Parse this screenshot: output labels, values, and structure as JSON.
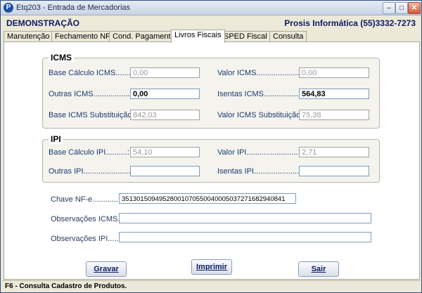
{
  "window": {
    "title": "Etq203 - Entrada de Mercadorias",
    "icon_letter": "P"
  },
  "header": {
    "demo": "DEMONSTRAÇÃO",
    "company": "Prosis Informática (55)3332-7273"
  },
  "tabs": [
    {
      "label": "Manutenção"
    },
    {
      "label": "Fechamento NF"
    },
    {
      "label": "Cond. Pagamento"
    },
    {
      "label": "Livros Fiscais",
      "active": true
    },
    {
      "label": "SPED Fiscal"
    },
    {
      "label": "Consulta"
    }
  ],
  "icms": {
    "title": "ICMS",
    "base_calculo": {
      "label": "Base Cálculo ICMS........:",
      "value": "0,00"
    },
    "valor": {
      "label": "Valor  ICMS.........................:",
      "value": "0,00"
    },
    "outras": {
      "label": "Outras  ICMS......................:",
      "value": "0,00"
    },
    "isentas": {
      "label": "Isentas  ICMS......................:",
      "value": "564,83"
    },
    "base_subst": {
      "label": "Base ICMS Substituição:",
      "value": "842,03"
    },
    "valor_subst": {
      "label": "Valor  ICMS Substituição:",
      "value": "75,38"
    }
  },
  "ipi": {
    "title": "IPI",
    "base_calculo": {
      "label": "Base Cálculo IPI..........:",
      "value": "54,10"
    },
    "valor": {
      "label": "Valor IPI...............................:",
      "value": "2,71"
    },
    "outras": {
      "label": "Outras   IPI..........................:",
      "value": ""
    },
    "isentas": {
      "label": "Isentas   IPI........................:",
      "value": ""
    }
  },
  "extra": {
    "chave": {
      "label": "Chave NF-e................:",
      "value": "35130150949528001070550040005037271682940841"
    },
    "obs_icms": {
      "label": "Observações ICMS.:",
      "value": ""
    },
    "obs_ipi": {
      "label": "Observações IPI.......:",
      "value": ""
    }
  },
  "buttons": {
    "gravar": "Gravar",
    "imprimir": "Imprimir",
    "sair": "Sair"
  },
  "status": {
    "text": "F6 - Consulta Cadastro de Produtos."
  }
}
